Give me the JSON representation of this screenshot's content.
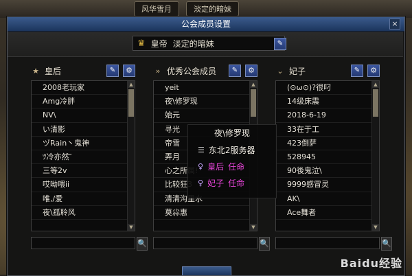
{
  "window": {
    "title": "公会成员设置",
    "close_label": "×"
  },
  "guild": {
    "crown_icon": "crown-icon",
    "rank": "皇帝",
    "name": "淡定的暗妹",
    "edit_label": "✎"
  },
  "panels": [
    {
      "title": "皇后",
      "icon": "star-icon",
      "members": [
        "2008老玩家",
        "Amg冷胖",
        "NV\\",
        "い清影",
        "ヅRain丶鬼神",
        "ﾂ冷亦然″",
        "三等2v",
        "哎呦喂ii",
        "唯,/爱",
        "夜\\孤聆风"
      ]
    },
    {
      "title": "优秀公会成员",
      "icon": "chevron-double-icon",
      "members": [
        "yeit",
        "夜\\修罗现",
        "始元",
        "寻光",
        "帝雪",
        "弄月",
        "心之所属!",
        "比较狂3",
        "清清沟里水",
        "莫尛惠"
      ]
    },
    {
      "title": "妃子",
      "icon": "chevron-down-icon",
      "members": [
        "(⊙ω⊙)?很叼",
        "14级床震",
        "2018-6-19",
        "33在于工",
        "423倒萨",
        "528945",
        "90後鬼泣\\",
        "9999感冒灵",
        "AK\\",
        "Ace舞者"
      ]
    }
  ],
  "context_menu": {
    "title": "夜\\修罗现",
    "server_item": "东北2服务器",
    "rank_items": [
      {
        "rank": "皇后",
        "action": "任命"
      },
      {
        "rank": "妃子",
        "action": "任命"
      }
    ]
  },
  "topbar": {
    "left_pill": "风华雪月",
    "right_pill": "淡定的暗妹"
  },
  "watermark": "Baidu经验",
  "colors": {
    "titlebar": "#1c355d",
    "highlight": "#e544d7",
    "accent_button": "#3b56a0"
  }
}
